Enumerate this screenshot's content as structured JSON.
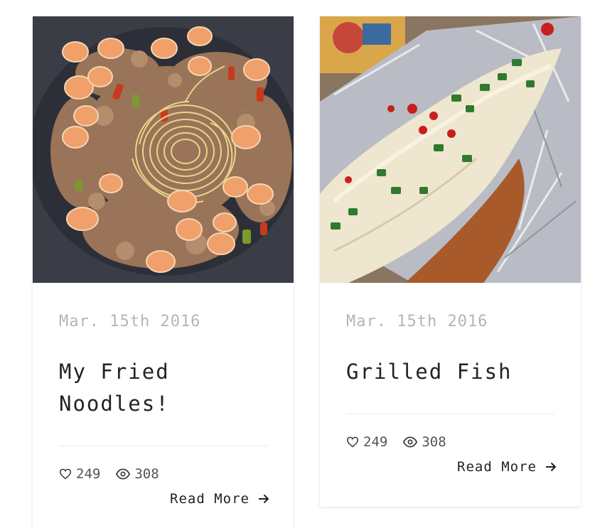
{
  "posts": [
    {
      "date": "Mar. 15th 2016",
      "title": "My Fried Noodles!",
      "likes": "249",
      "views": "308",
      "read_more": "Read More",
      "image_subject": "shrimp and noodle stir fry"
    },
    {
      "date": "Mar. 15th 2016",
      "title": "Grilled Fish",
      "likes": "249",
      "views": "308",
      "read_more": "Read More",
      "image_subject": "grilled fish in foil with chili and scallion"
    }
  ],
  "icons": {
    "like": "heart-icon",
    "views": "eye-icon",
    "read_more": "arrow-right-icon"
  },
  "colors": {
    "date_text": "#b5b5b5",
    "title_text": "#222222",
    "meta_text": "#555555",
    "divider": "#e8e8e8"
  }
}
